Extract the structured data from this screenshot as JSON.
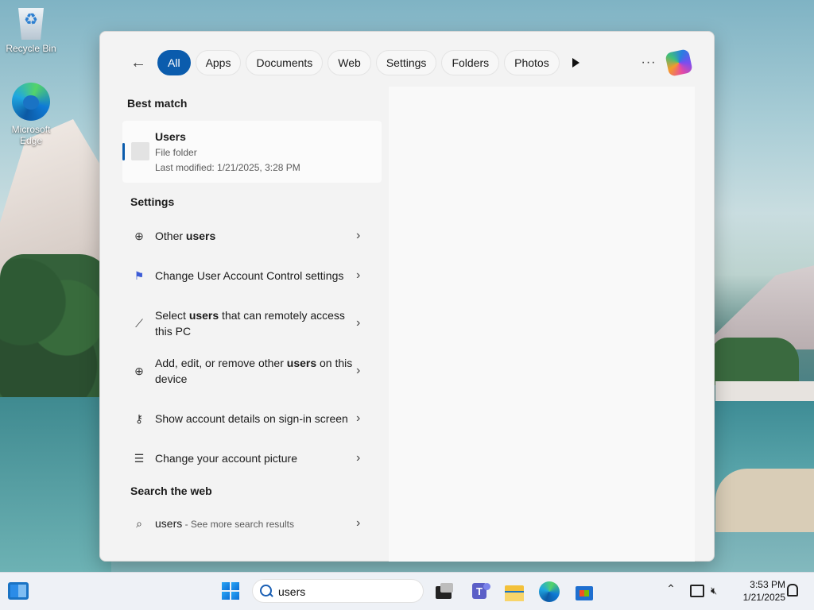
{
  "desktop": {
    "icons": [
      {
        "label": "Recycle Bin"
      },
      {
        "label": "Microsoft Edge"
      }
    ]
  },
  "search_panel": {
    "filters": [
      "All",
      "Apps",
      "Documents",
      "Web",
      "Settings",
      "Folders",
      "Photos"
    ],
    "active_filter": "All",
    "more_label": "···",
    "best_match": {
      "section_title": "Best match",
      "name": "Users",
      "type": "File folder",
      "modified": "Last modified: 1/21/2025, 3:28 PM"
    },
    "settings": {
      "section_title": "Settings",
      "items": [
        {
          "icon": "user-add-icon",
          "pre": "Other ",
          "bold": "users",
          "post": ""
        },
        {
          "icon": "uac-flag-icon",
          "pre": "Change User Account Control settings",
          "bold": "",
          "post": ""
        },
        {
          "icon": "remote-access-icon",
          "pre": "Select ",
          "bold": "users",
          "post": " that can remotely access this PC"
        },
        {
          "icon": "user-add-icon",
          "pre": "Add, edit, or remove other ",
          "bold": "users",
          "post": " on this device"
        },
        {
          "icon": "key-icon",
          "pre": "Show account details on sign-in screen",
          "bold": "",
          "post": ""
        },
        {
          "icon": "account-picture-icon",
          "pre": "Change your account picture",
          "bold": "",
          "post": ""
        }
      ]
    },
    "web": {
      "section_title": "Search the web",
      "query": "users",
      "suffix": " - See more search results"
    }
  },
  "taskbar": {
    "search_value": "users",
    "time": "3:53 PM",
    "date": "1/21/2025"
  }
}
